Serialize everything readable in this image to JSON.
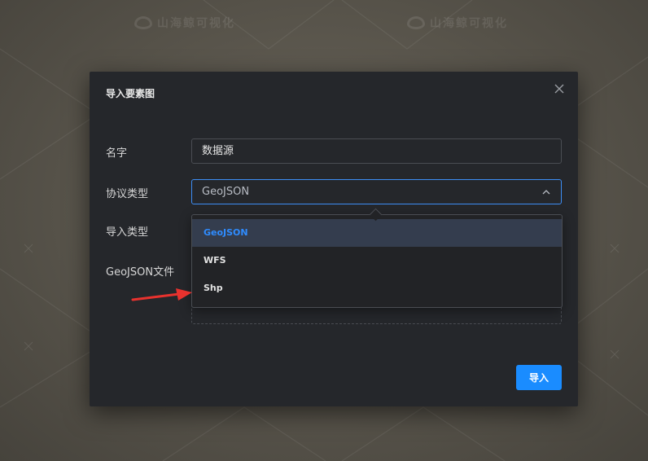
{
  "watermark": {
    "text": "山海鲸可视化"
  },
  "dialog": {
    "title": "导入要素图",
    "close_icon": "close-icon"
  },
  "form": {
    "name_label": "名字",
    "name_value": "数据源",
    "protocol_label": "协议类型",
    "protocol_value": "GeoJSON",
    "import_type_label": "导入类型",
    "file_label": "GeoJSON文件"
  },
  "dropdown": {
    "options": [
      {
        "label": "GeoJSON",
        "selected": true
      },
      {
        "label": "WFS",
        "selected": false
      },
      {
        "label": "Shp",
        "selected": false
      }
    ]
  },
  "actions": {
    "import_label": "导入"
  },
  "colors": {
    "accent": "#1a8cff",
    "selected_text": "#2f8cff",
    "annotation_arrow": "#e8322e",
    "dialog_bg": "#25272b"
  }
}
